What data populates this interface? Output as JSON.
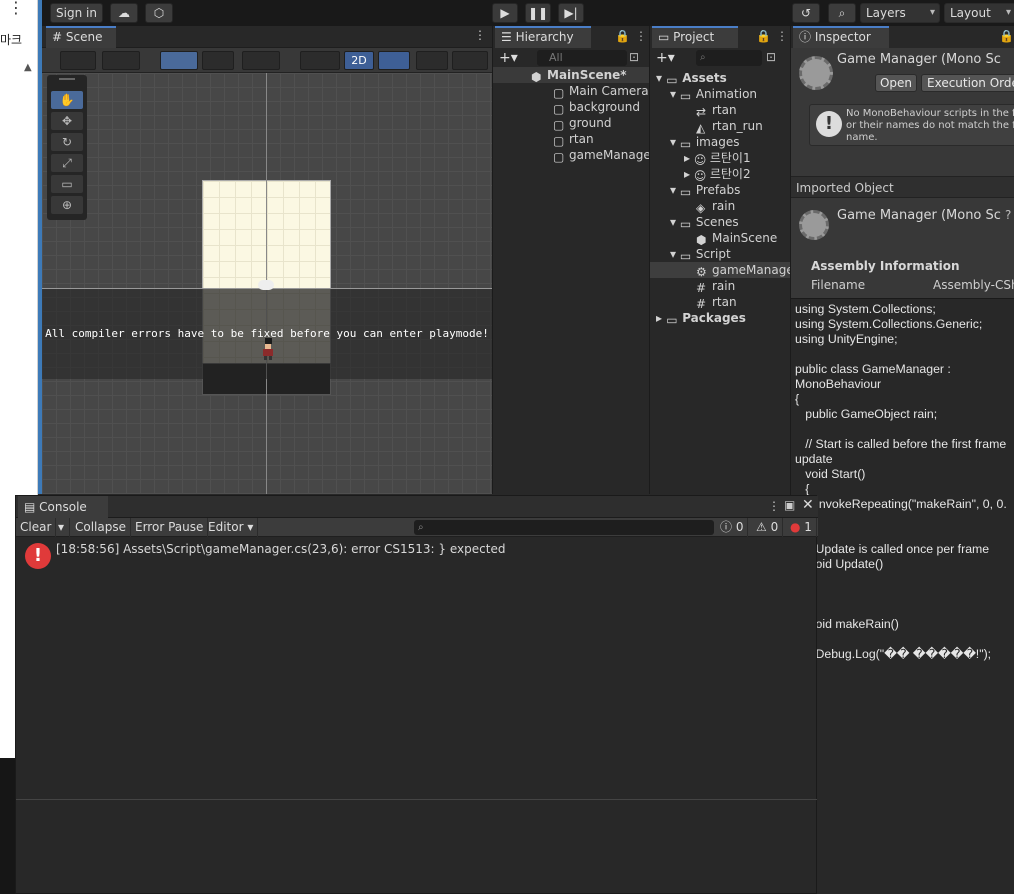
{
  "side_strip": {
    "menu": "⋮",
    "label": "마크"
  },
  "toolbar": {
    "sign_in": "Sign in",
    "layers": "Layers",
    "layout": "Layout"
  },
  "scene": {
    "tab": "Scene",
    "mode_2d": "2D",
    "compile_message": "All compiler errors have to be fixed before you can enter playmode!"
  },
  "hierarchy": {
    "tab": "Hierarchy",
    "search_placeholder": "All",
    "scene_name": "MainScene*",
    "items": [
      "Main Camera",
      "background",
      "ground",
      "rtan",
      "gameManage"
    ]
  },
  "project": {
    "tab": "Project",
    "tree": [
      {
        "label": "Assets",
        "level": 0,
        "kind": "folder",
        "bold": true
      },
      {
        "label": "Animation",
        "level": 1,
        "kind": "folder"
      },
      {
        "label": "rtan",
        "level": 2,
        "kind": "anim"
      },
      {
        "label": "rtan_run",
        "level": 2,
        "kind": "clip"
      },
      {
        "label": "images",
        "level": 1,
        "kind": "folder"
      },
      {
        "label": "르탄이1",
        "level": 2,
        "kind": "sprite"
      },
      {
        "label": "르탄이2",
        "level": 2,
        "kind": "sprite"
      },
      {
        "label": "Prefabs",
        "level": 1,
        "kind": "folder"
      },
      {
        "label": "rain",
        "level": 2,
        "kind": "prefab"
      },
      {
        "label": "Scenes",
        "level": 1,
        "kind": "folder"
      },
      {
        "label": "MainScene",
        "level": 2,
        "kind": "unity"
      },
      {
        "label": "Script",
        "level": 1,
        "kind": "folder"
      },
      {
        "label": "gameManage",
        "level": 2,
        "kind": "gear",
        "selected": true
      },
      {
        "label": "rain",
        "level": 2,
        "kind": "cs"
      },
      {
        "label": "rtan",
        "level": 2,
        "kind": "cs"
      },
      {
        "label": "Packages",
        "level": 0,
        "kind": "folder",
        "bold": true
      }
    ]
  },
  "inspector": {
    "tab": "Inspector",
    "title": "Game Manager (Mono Sc",
    "open_button": "Open",
    "exec_order_button": "Execution Order",
    "warning_text": "No MonoBehaviour scripts in the fi or their names do not match the fi name.",
    "imported_object": "Imported Object",
    "title2": "Game Manager (Mono Sc",
    "assembly_info": "Assembly Information",
    "filename_label": "Filename",
    "filename_value": "Assembly-CSh",
    "code": "using System.Collections;\nusing System.Collections.Generic;\nusing UnityEngine;\n\npublic class GameManager :\nMonoBehaviour\n{\n   public GameObject rain;\n\n   // Start is called before the first frame\nupdate\n   void Start()\n   {\n      InvokeRepeating(\"makeRain\", 0, 0.\n\n\n      Update is called once per frame\n      oid Update()\n\n\n\n      oid makeRain()\n\n      Debug.Log(\"�� �����!\");"
  },
  "console": {
    "tab": "Console",
    "clear": "Clear",
    "collapse": "Collapse",
    "error_pause": "Error Pause",
    "editor": "Editor",
    "info_count": "0",
    "warn_count": "0",
    "error_count": "1",
    "error_message": "[18:58:56] Assets\\Script\\gameManager.cs(23,6): error CS1513: } expected"
  },
  "colors": {
    "accent": "#4a7ec7",
    "error": "#e03a3a",
    "selection": "#3e5f96"
  }
}
